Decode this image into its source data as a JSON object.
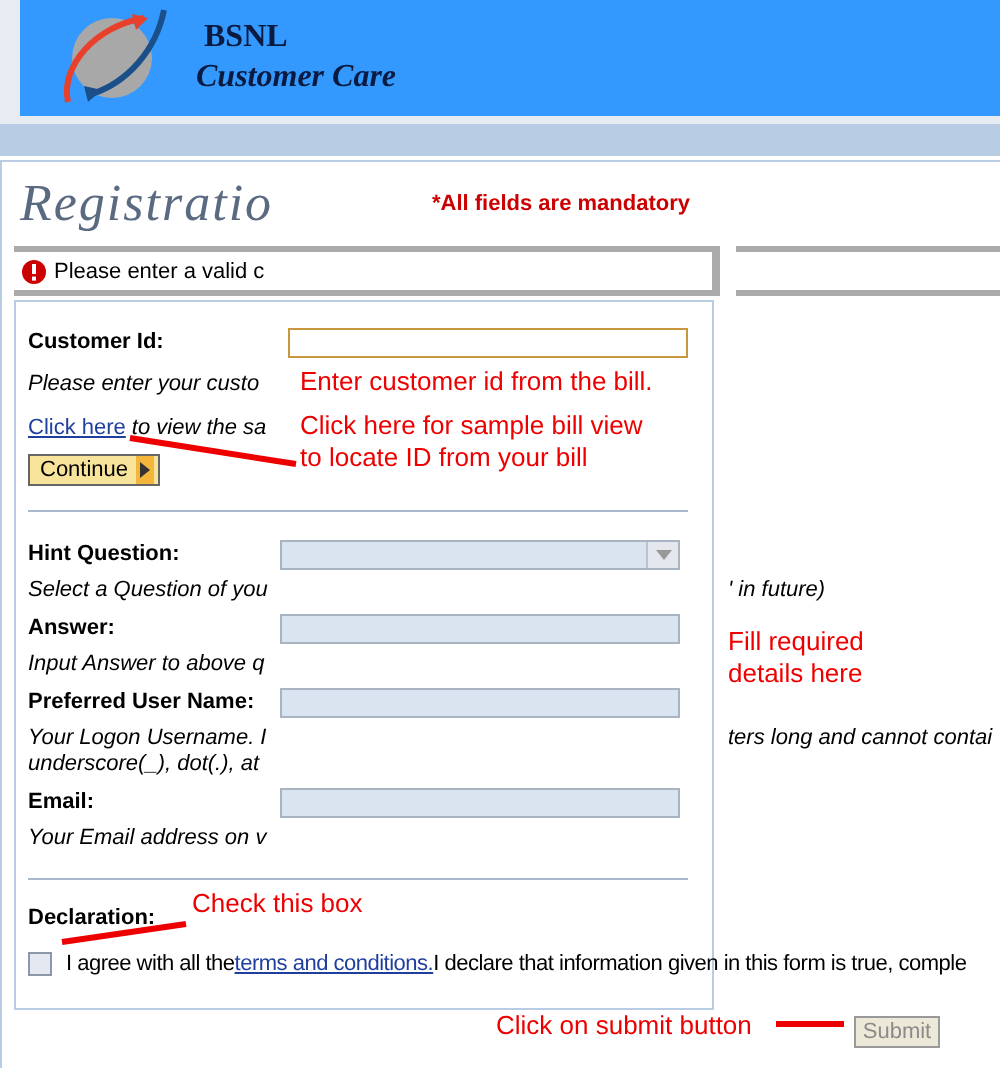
{
  "header": {
    "brand": "BSNL",
    "subtitle": "Customer Care"
  },
  "page": {
    "title": "Registratio",
    "mandatory_note": "*All fields are mandatory"
  },
  "error": {
    "message": "Please enter a valid c"
  },
  "customer_id": {
    "label": "Customer Id:",
    "highlighted": true,
    "help": "Please enter your custo",
    "link": "Click here",
    "link_rest": "to view the sa",
    "continue_button": "Continue"
  },
  "fields": [
    {
      "kind": "select",
      "label": "Hint Question:",
      "help": [
        {
          "left": "Select a Question of you",
          "right": "' in future)"
        }
      ]
    },
    {
      "kind": "text",
      "label": "Answer:",
      "help": [
        {
          "left": "Input Answer to above q"
        }
      ]
    },
    {
      "kind": "text",
      "label": "Preferred User Name:",
      "help": [
        {
          "left": "Your Logon Username. I",
          "right": "ters long and cannot contai"
        },
        {
          "left": "underscore(_), dot(.), at"
        }
      ]
    },
    {
      "kind": "text",
      "label": "Email:",
      "help": [
        {
          "left": "Your Email address on v"
        }
      ]
    }
  ],
  "declaration": {
    "label": "Declaration:",
    "checked": false,
    "text_before": "I agree with all the",
    "link": "terms and conditions.",
    "text_after": "I declare that information given in this form is true, comple"
  },
  "submit": {
    "label": "Submit",
    "disabled": true
  },
  "annotations": [
    {
      "lines": [
        "Enter customer id from the bill."
      ]
    },
    {
      "lines": [
        "Click here for sample bill view",
        "to locate ID from your bill"
      ]
    },
    {
      "lines": [
        "Fill required",
        "details here"
      ]
    },
    {
      "lines": [
        "Check this box"
      ]
    },
    {
      "lines": [
        "Click on submit button"
      ]
    }
  ]
}
